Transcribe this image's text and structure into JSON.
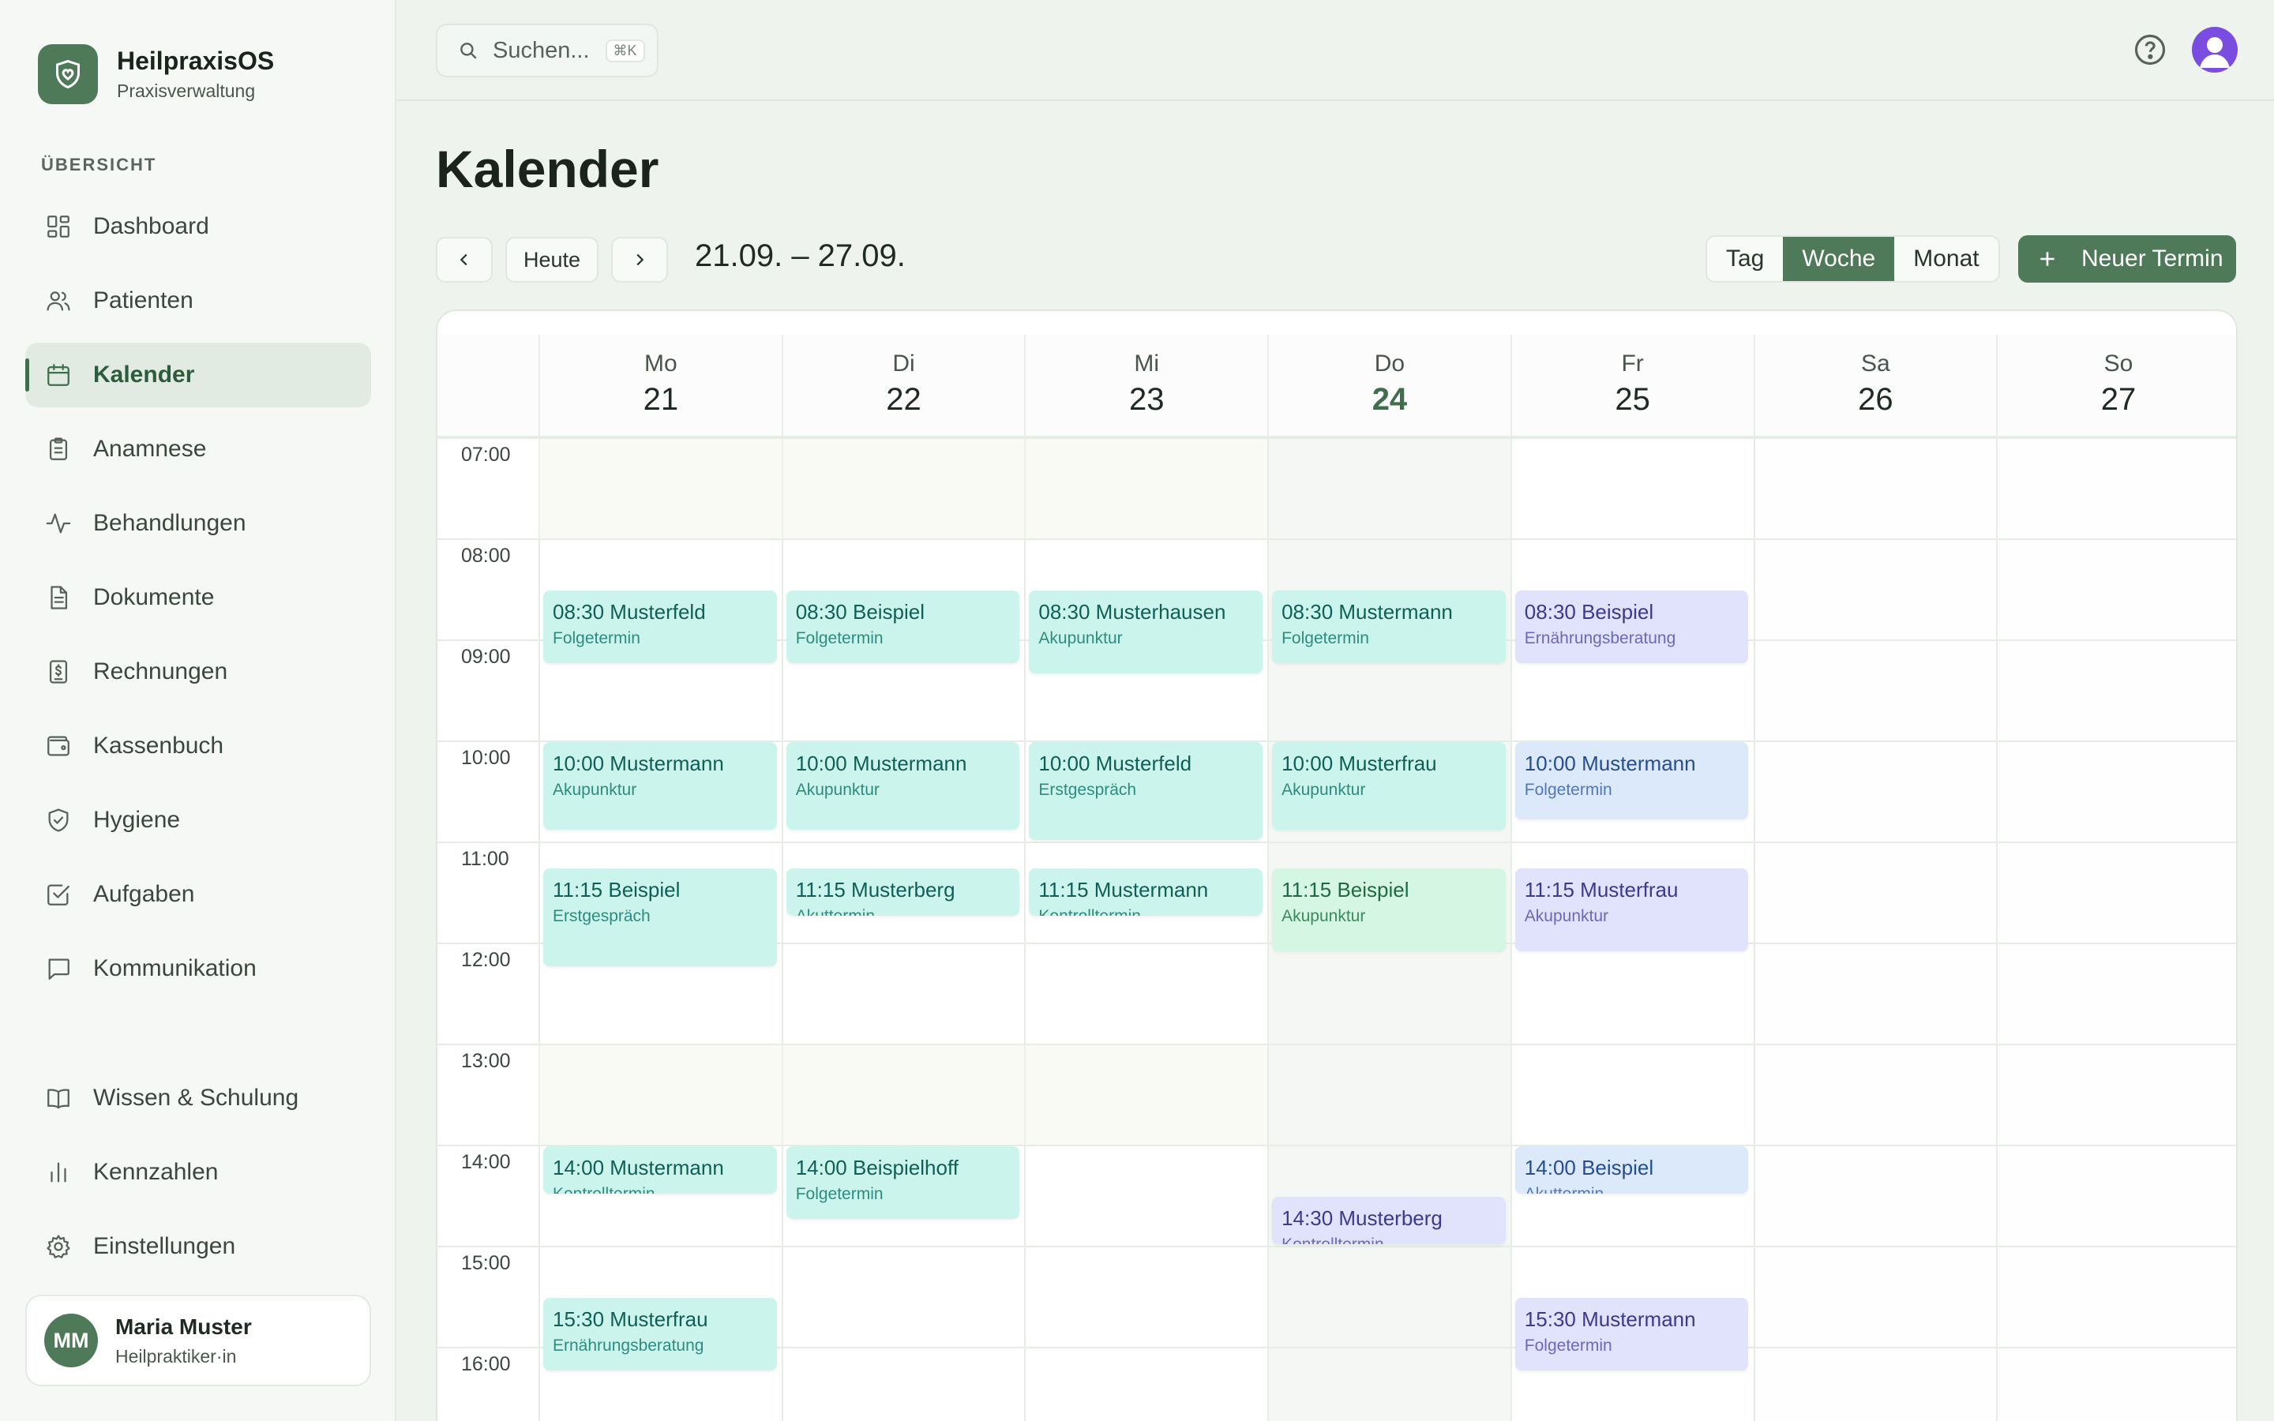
{
  "brand": {
    "name": "HeilpraxisOS",
    "subtitle": "Praxisverwaltung"
  },
  "sidebar": {
    "section": "ÜBERSICHT",
    "items": [
      {
        "label": "Dashboard",
        "icon": "dashboard-icon"
      },
      {
        "label": "Patienten",
        "icon": "users-icon"
      },
      {
        "label": "Kalender",
        "icon": "calendar-icon",
        "active": true
      },
      {
        "label": "Anamnese",
        "icon": "clipboard-icon"
      },
      {
        "label": "Behandlungen",
        "icon": "activity-icon"
      },
      {
        "label": "Dokumente",
        "icon": "document-icon"
      },
      {
        "label": "Rechnungen",
        "icon": "invoice-icon"
      },
      {
        "label": "Kassenbuch",
        "icon": "wallet-icon"
      },
      {
        "label": "Hygiene",
        "icon": "shield-check-icon"
      },
      {
        "label": "Aufgaben",
        "icon": "checkbox-icon"
      },
      {
        "label": "Kommunikation",
        "icon": "chat-icon"
      }
    ],
    "bottom_items": [
      {
        "label": "Wissen & Schulung",
        "icon": "book-icon"
      },
      {
        "label": "Kennzahlen",
        "icon": "bar-chart-icon"
      },
      {
        "label": "Einstellungen",
        "icon": "gear-icon"
      }
    ],
    "user": {
      "initials": "MM",
      "name": "Maria Muster",
      "role": "Heilpraktiker·in"
    }
  },
  "topbar": {
    "search_placeholder": "Suchen...",
    "shortcut": "⌘K"
  },
  "page": {
    "title": "Kalender"
  },
  "toolbar": {
    "prev": "‹",
    "today": "Heute",
    "next": "›",
    "range": "21.09. – 27.09.",
    "views": [
      "Tag",
      "Woche",
      "Monat"
    ],
    "active_view": "Woche",
    "new_button": "Neuer Termin"
  },
  "calendar": {
    "days": [
      {
        "dow": "Mo",
        "num": "21"
      },
      {
        "dow": "Di",
        "num": "22"
      },
      {
        "dow": "Mi",
        "num": "23"
      },
      {
        "dow": "Do",
        "num": "24",
        "today": true
      },
      {
        "dow": "Fr",
        "num": "25"
      },
      {
        "dow": "Sa",
        "num": "26"
      },
      {
        "dow": "So",
        "num": "27"
      }
    ],
    "hours": [
      "07:00",
      "08:00",
      "09:00",
      "10:00",
      "11:00",
      "12:00",
      "13:00",
      "14:00",
      "15:00",
      "16:00"
    ],
    "events": [
      {
        "day": 0,
        "start": 8.5,
        "end": 9.25,
        "title": "08:30 Musterfeld",
        "type": "Folgetermin",
        "color": "teal"
      },
      {
        "day": 0,
        "start": 10.0,
        "end": 10.9,
        "title": "10:00 Mustermann",
        "type": "Akupunktur",
        "color": "teal"
      },
      {
        "day": 0,
        "start": 11.25,
        "end": 12.25,
        "title": "11:15 Beispiel",
        "type": "Erstgespräch",
        "color": "teal"
      },
      {
        "day": 0,
        "start": 14.0,
        "end": 14.5,
        "title": "14:00 Mustermann",
        "type": "Kontrolltermin",
        "color": "teal"
      },
      {
        "day": 0,
        "start": 15.5,
        "end": 16.25,
        "title": "15:30 Musterfrau",
        "type": "Ernährungsberatung",
        "color": "teal"
      },
      {
        "day": 1,
        "start": 8.5,
        "end": 9.25,
        "title": "08:30 Beispiel",
        "type": "Folgetermin",
        "color": "teal"
      },
      {
        "day": 1,
        "start": 10.0,
        "end": 10.9,
        "title": "10:00 Mustermann",
        "type": "Akupunktur",
        "color": "teal"
      },
      {
        "day": 1,
        "start": 11.25,
        "end": 11.75,
        "title": "11:15 Musterberg",
        "type": "Akuttermin",
        "color": "teal"
      },
      {
        "day": 1,
        "start": 14.0,
        "end": 14.75,
        "title": "14:00 Beispielhoff",
        "type": "Folgetermin",
        "color": "teal"
      },
      {
        "day": 2,
        "start": 8.5,
        "end": 9.35,
        "title": "08:30 Musterhausen",
        "type": "Akupunktur",
        "color": "teal"
      },
      {
        "day": 2,
        "start": 10.0,
        "end": 11.0,
        "title": "10:00 Musterfeld",
        "type": "Erstgespräch",
        "color": "teal"
      },
      {
        "day": 2,
        "start": 11.25,
        "end": 11.75,
        "title": "11:15 Mustermann",
        "type": "Kontrolltermin",
        "color": "teal"
      },
      {
        "day": 3,
        "start": 8.5,
        "end": 9.25,
        "title": "08:30 Mustermann",
        "type": "Folgetermin",
        "color": "teal"
      },
      {
        "day": 3,
        "start": 10.0,
        "end": 10.9,
        "title": "10:00 Musterfrau",
        "type": "Akupunktur",
        "color": "teal"
      },
      {
        "day": 3,
        "start": 11.25,
        "end": 12.1,
        "title": "11:15 Beispiel",
        "type": "Akupunktur",
        "color": "green"
      },
      {
        "day": 3,
        "start": 14.5,
        "end": 15.0,
        "title": "14:30 Musterberg",
        "type": "Kontrolltermin",
        "color": "purple"
      },
      {
        "day": 4,
        "start": 8.5,
        "end": 9.25,
        "title": "08:30 Beispiel",
        "type": "Ernährungsberatung",
        "color": "purple"
      },
      {
        "day": 4,
        "start": 10.0,
        "end": 10.8,
        "title": "10:00 Mustermann",
        "type": "Folgetermin",
        "color": "blue"
      },
      {
        "day": 4,
        "start": 11.25,
        "end": 12.1,
        "title": "11:15 Musterfrau",
        "type": "Akupunktur",
        "color": "purple"
      },
      {
        "day": 4,
        "start": 14.0,
        "end": 14.5,
        "title": "14:00 Beispiel",
        "type": "Akuttermin",
        "color": "blue"
      },
      {
        "day": 4,
        "start": 15.5,
        "end": 16.25,
        "title": "15:30 Mustermann",
        "type": "Folgetermin",
        "color": "purple"
      }
    ]
  }
}
